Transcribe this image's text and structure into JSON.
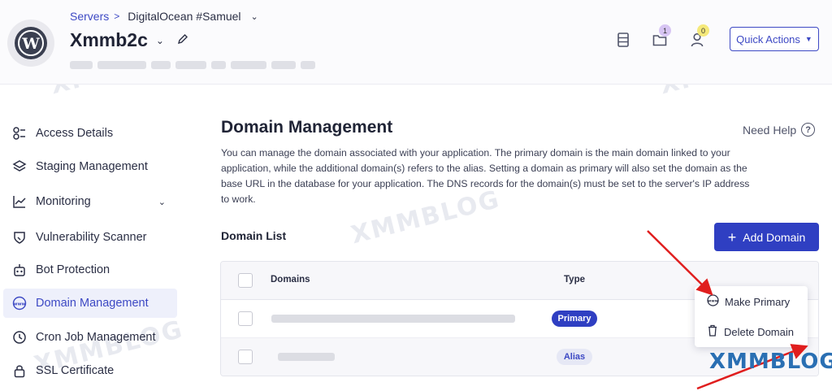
{
  "breadcrumb": {
    "servers_label": "Servers",
    "separator": ">",
    "server_name": "DigitalOcean #Samuel"
  },
  "app": {
    "name": "Xmmb2c"
  },
  "header_icons": [
    {
      "icon": "list-icon"
    },
    {
      "icon": "folder-icon",
      "badge": "1",
      "badge_color": "#d7c5f3"
    },
    {
      "icon": "user-icon",
      "badge": "0",
      "badge_color": "#f5e97a"
    }
  ],
  "quick_actions": {
    "label": "Quick Actions"
  },
  "sidebar": {
    "items": [
      {
        "label": "Access Details",
        "icon": "key-icon"
      },
      {
        "label": "Staging Management",
        "icon": "layers-icon"
      },
      {
        "label": "Monitoring",
        "icon": "chart-line-icon"
      },
      {
        "label": "Vulnerability Scanner",
        "icon": "shield-icon"
      },
      {
        "label": "Bot Protection",
        "icon": "bot-icon"
      },
      {
        "label": "Domain Management",
        "icon": "www-icon"
      },
      {
        "label": "Cron Job Management",
        "icon": "clock-icon"
      },
      {
        "label": "SSL Certificate",
        "icon": "lock-icon"
      }
    ]
  },
  "main": {
    "title": "Domain Management",
    "need_help": "Need Help",
    "description": "You can manage the domain associated with your application. The primary domain is the main domain linked to your application, while the additional domain(s) refers to the alias. Setting a domain as primary will also set the domain as the base URL in the database for your application. The DNS records for the domain(s) must be set to the server's IP address to work.",
    "domain_list_label": "Domain List",
    "add_domain_label": "Add Domain"
  },
  "table": {
    "headers": {
      "domains": "Domains",
      "type": "Type"
    },
    "rows": [
      {
        "type": "Primary"
      },
      {
        "type": "Alias"
      }
    ]
  },
  "dropdown": {
    "make_primary": "Make Primary",
    "delete_domain": "Delete Domain"
  },
  "watermark": {
    "text": "XMMBLOG"
  },
  "colors": {
    "accent": "#2f3fc2",
    "annotation_arrow": "#e01e1e"
  }
}
